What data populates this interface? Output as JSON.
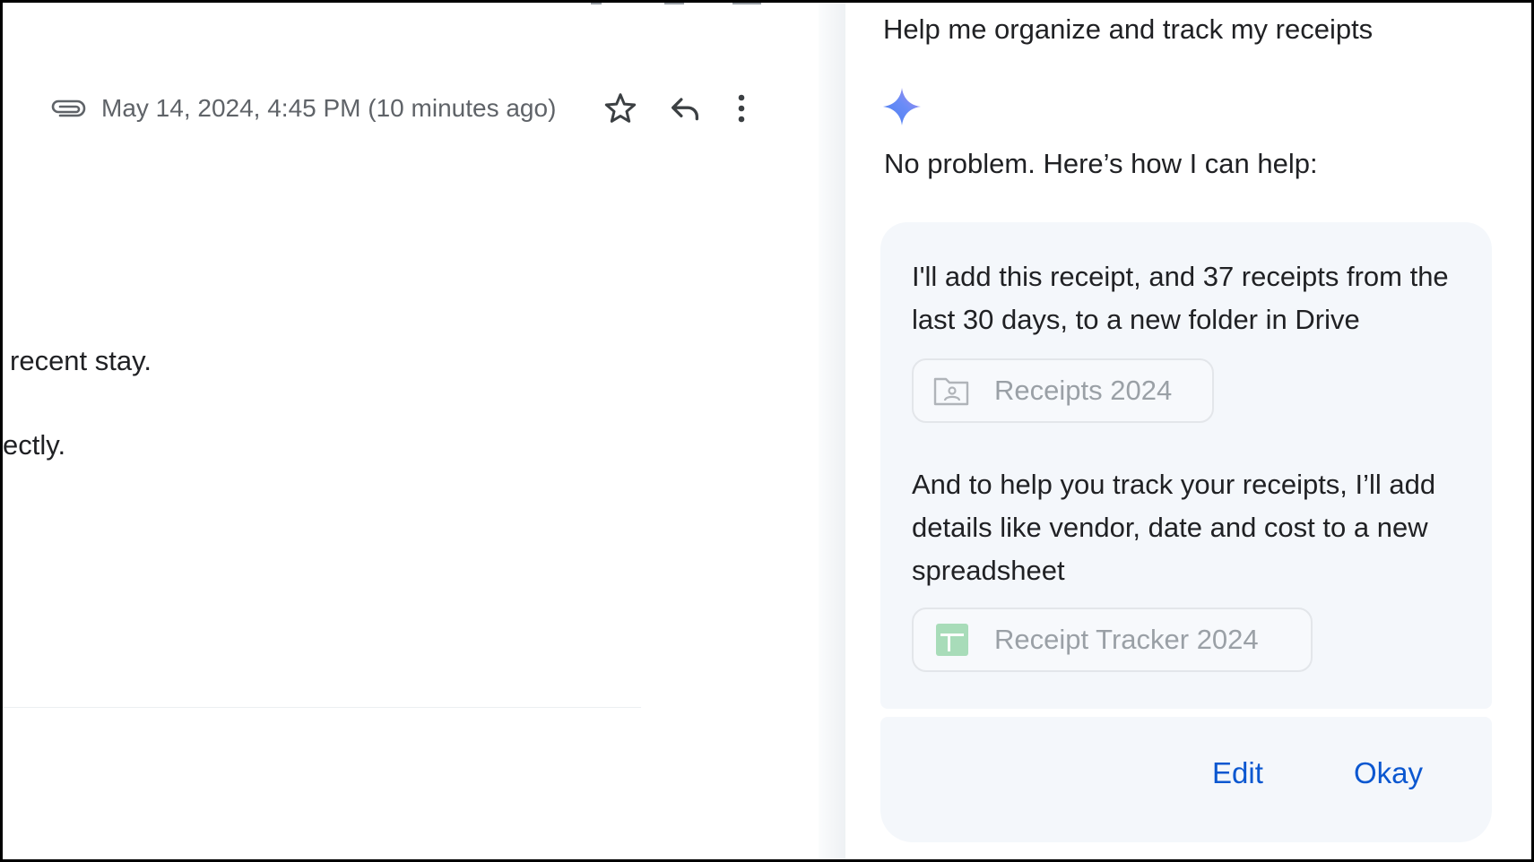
{
  "email": {
    "timestamp": "May 14, 2024, 4:45 PM (10 minutes ago)",
    "body_lines": [
      "recent stay.",
      "ectly."
    ],
    "icons": {
      "attachment": "paperclip-icon",
      "star": "star-outline-icon",
      "reply": "reply-icon",
      "more": "more-vert-icon"
    }
  },
  "assistant": {
    "user_prompt": "Help me organize and track my receipts",
    "icon": "gemini-sparkle-icon",
    "reply_intro": "No problem. Here’s how I can help:",
    "steps": [
      {
        "text": "I'll add this receipt, and 37 receipts from the last 30 days, to a new folder in Drive",
        "chip": {
          "label": "Receipts 2024",
          "icon": "drive-folder-icon"
        }
      },
      {
        "text": "And to help you track your receipts, I’ll add details like vendor, date and cost to a new spreadsheet",
        "chip": {
          "label": "Receipt Tracker 2024",
          "icon": "sheets-icon"
        }
      }
    ],
    "actions": {
      "edit": "Edit",
      "okay": "Okay"
    },
    "colors": {
      "action": "#0b57d0",
      "card_bg": "#f4f7fb",
      "sheets_green": "#34a853"
    }
  }
}
